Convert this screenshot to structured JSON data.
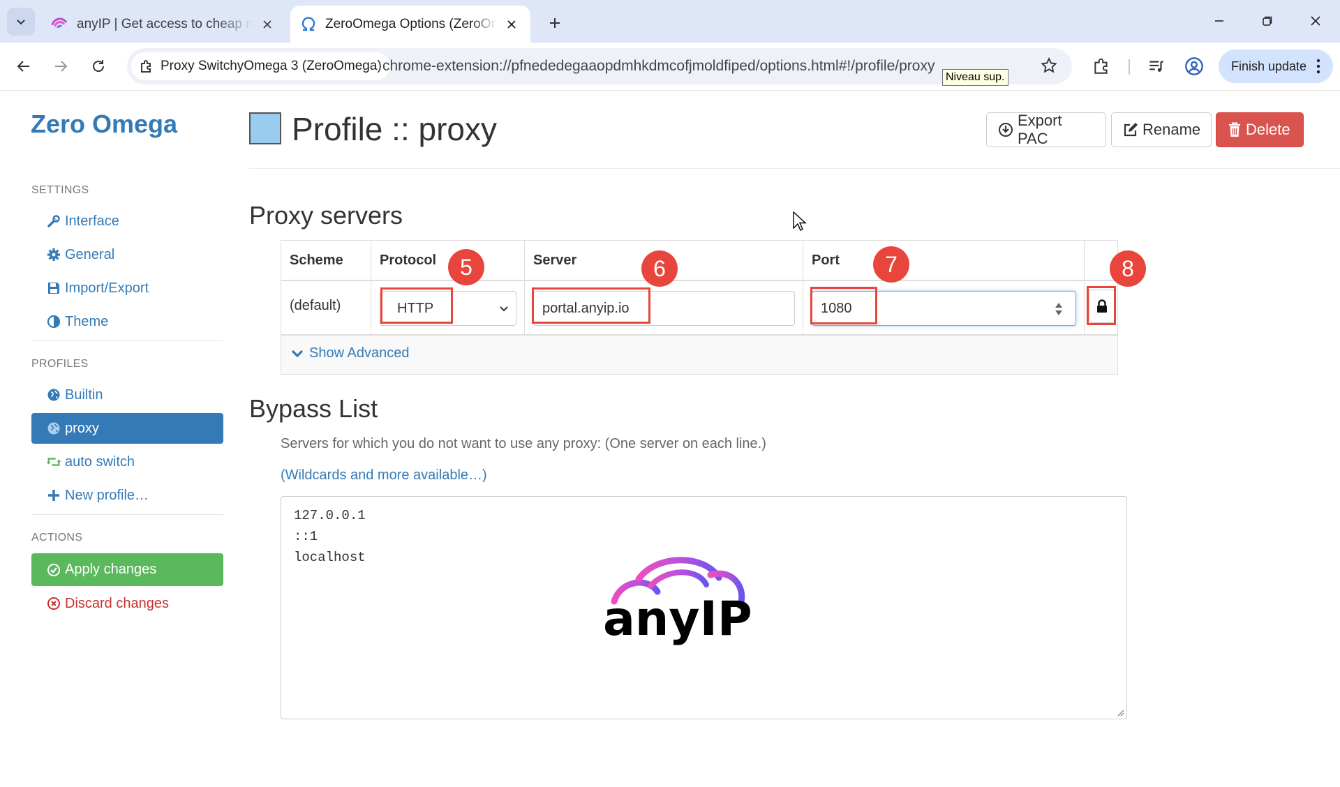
{
  "browser": {
    "tabs": [
      {
        "title": "anyIP | Get access to cheap mobile proxies",
        "active": false
      },
      {
        "title": "ZeroOmega Options (ZeroOmega)",
        "active": true
      }
    ],
    "site_chip": "Proxy SwitchyOmega 3 (ZeroOmega)",
    "url": "chrome-extension://pfnededegaaopdmhkdmcofjmoldfiped/options.html#!/profile/proxy",
    "tooltip": "Niveau sup.",
    "finish_update": "Finish update"
  },
  "sidebar": {
    "brand": "Zero Omega",
    "settings_header": "SETTINGS",
    "settings": [
      {
        "label": "Interface",
        "icon": "wrench-icon"
      },
      {
        "label": "General",
        "icon": "gear-icon"
      },
      {
        "label": "Import/Export",
        "icon": "floppy-icon"
      },
      {
        "label": "Theme",
        "icon": "contrast-icon"
      }
    ],
    "profiles_header": "PROFILES",
    "profiles": [
      {
        "label": "Builtin",
        "icon": "globe-icon"
      },
      {
        "label": "proxy",
        "icon": "globe-icon",
        "active": true
      },
      {
        "label": "auto switch",
        "icon": "retweet-icon"
      },
      {
        "label": "New profile…",
        "icon": "plus-icon"
      }
    ],
    "actions_header": "ACTIONS",
    "actions": {
      "apply": "Apply changes",
      "discard": "Discard changes"
    }
  },
  "main": {
    "title": "Profile :: proxy",
    "profile_color": "#99ccee",
    "buttons": {
      "export": "Export PAC",
      "rename": "Rename",
      "delete": "Delete"
    },
    "proxy_section": "Proxy servers",
    "table": {
      "headers": [
        "Scheme",
        "Protocol",
        "Server",
        "Port"
      ],
      "row": {
        "scheme": "(default)",
        "protocol": "HTTP",
        "server": "portal.anyip.io",
        "port": "1080"
      },
      "show_advanced": "Show Advanced"
    },
    "annotations": [
      "5",
      "6",
      "7",
      "8"
    ],
    "bypass_section": "Bypass List",
    "bypass_help": "Servers for which you do not want to use any proxy: (One server on each line.)",
    "bypass_link": "(Wildcards and more available…)",
    "bypass_lines": [
      "127.0.0.1",
      "::1",
      "localhost"
    ],
    "watermark": "anyIP"
  },
  "colors": {
    "accent": "#337ab7",
    "success": "#5cb85c",
    "danger": "#d9534f",
    "annotation": "#e8453c"
  }
}
